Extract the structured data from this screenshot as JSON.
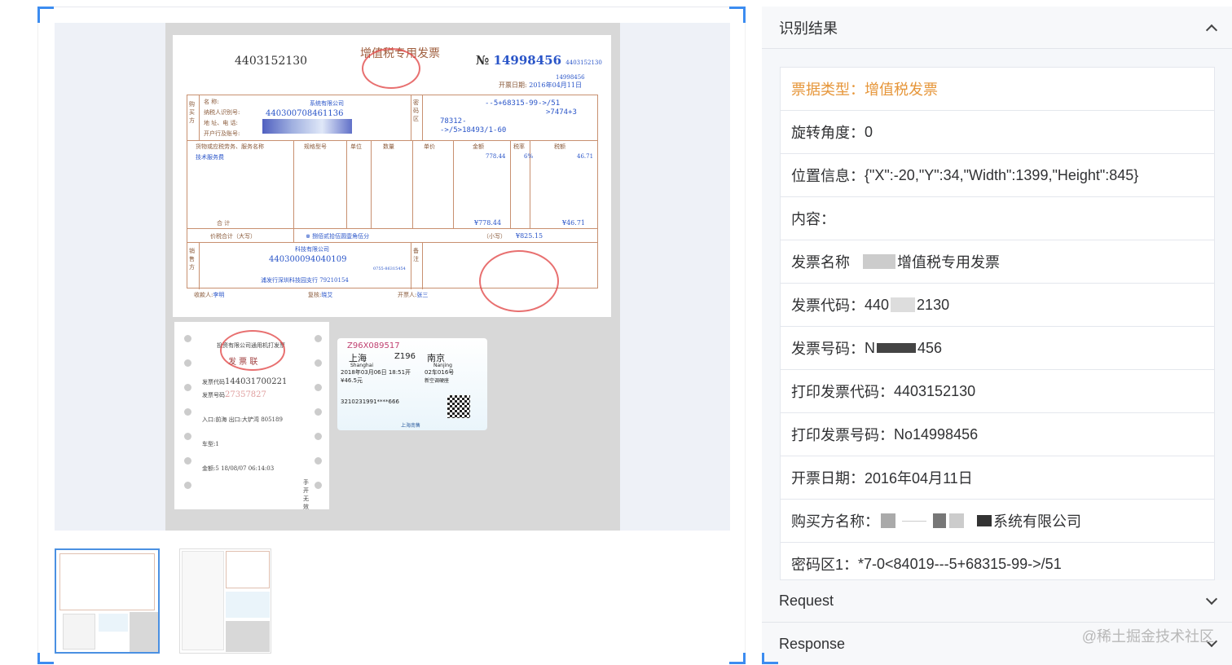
{
  "viewer": {
    "invoice": {
      "code": "4403152130",
      "title": "增值税专用发票",
      "no_label": "№",
      "no": "14998456",
      "code_small": "4403152130",
      "no_small": "14998456",
      "date_label": "开票日期:",
      "date": "2016年04月11日",
      "buyer_company": "系统有限公司",
      "buyer_tax_id": "440300708461136",
      "cipher1": "--5+68315-99->/51",
      "cipher2": ">7474+3",
      "cipher3": "78312-",
      "cipher4": "->/5>18493/1-60",
      "col_headers": [
        "货物或应税劳务、服务名称",
        "规格型号",
        "单位",
        "数量",
        "单价",
        "金额",
        "税率",
        "税额"
      ],
      "item_name": "技术服务费",
      "amount": "778.44",
      "tax_rate": "6%",
      "tax": "46.71",
      "sum_label": "合   计",
      "sum_amount": "¥778.44",
      "sum_tax": "¥46.71",
      "total_label": "价税合计（大写）",
      "total_words": "⊗ 捌佰贰拾伍圆壹角伍分",
      "total_small_label": "（小写）",
      "total": "¥825.15",
      "seller_company": "科技有限公司",
      "seller_tax_id": "440300094040109",
      "seller_bank": "浦发行深圳科技园支行 79210154",
      "seller_phone": "0755-86315454",
      "payee_label": "收款人:",
      "payee": "李明",
      "reviewer_label": "复核:",
      "reviewer": "晓艾",
      "drawer_label": "开票人:",
      "drawer": "张三",
      "buyer_labels": [
        "名    称:",
        "纳税人识别号:",
        "地 址、电 话:",
        "开户行及账号:"
      ],
      "side_buyer": "购买方",
      "side_seller": "销售方",
      "cipher_label": "密码区",
      "remark_label": "备注"
    },
    "receipt": {
      "title": "投资有限公司通用机打发票",
      "subtitle": "发  票  联",
      "code_label": "发票代码",
      "code": "144031700221",
      "no_label": "发票号码",
      "no": "27357827",
      "entry_label": "入口:",
      "entry": "前海",
      "exit_label": "出口:",
      "exit": "大铲湾",
      "collector": "805189",
      "type_label": "车型:",
      "type": "1",
      "amount_label": "金额:",
      "amount": "5",
      "time": "18/08/07 06:14:03",
      "handwrite": "手开无效"
    },
    "ticket": {
      "serial": "Z96X089517",
      "from": "上海",
      "from_en": "Shanghai",
      "train": "Z196",
      "to": "南京",
      "to_en": "Nanjing",
      "datetime": "2018年03月06日 18:51开",
      "seat": "02车016号",
      "price": "¥46.5元",
      "class": "新空调硬座",
      "id": "3210231991****666",
      "footer": "上海南售"
    }
  },
  "results": {
    "title": "识别结果",
    "items": [
      {
        "label": "票据类型：",
        "value": "增值税发票"
      },
      {
        "label": "旋转角度：",
        "value": "0"
      },
      {
        "label": "位置信息：",
        "value": "{\"X\":-20,\"Y\":34,\"Width\":1399,\"Height\":845}"
      },
      {
        "label": "内容：",
        "value": ""
      },
      {
        "label": "发票名称",
        "value": "增值税专用发票"
      },
      {
        "label": "发票代码：",
        "value": "440",
        "value2": "2130"
      },
      {
        "label": "发票号码：",
        "value": "N",
        "value2": "456"
      },
      {
        "label": "打印发票代码：",
        "value": "4403152130"
      },
      {
        "label": "打印发票号码：",
        "value": "No14998456"
      },
      {
        "label": "开票日期：",
        "value": "2016年04月11日"
      },
      {
        "label": "购买方名称：",
        "value": "系统有限公司"
      },
      {
        "label": "密码区1：",
        "value": "*7-0<84019---5+68315-99->/51"
      }
    ]
  },
  "request": {
    "title": "Request"
  },
  "response": {
    "title": "Response"
  },
  "watermark": "@稀土掘金技术社区",
  "colors": {
    "accent": "#3c8cf0",
    "highlight": "#e6963a"
  }
}
